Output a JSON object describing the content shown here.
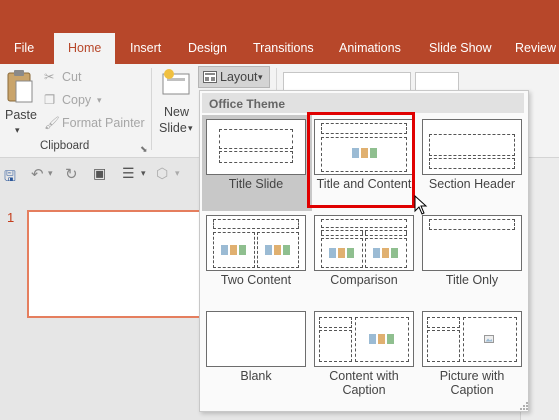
{
  "tabs": [
    "File",
    "Home",
    "Insert",
    "Design",
    "Transitions",
    "Animations",
    "Slide Show",
    "Review"
  ],
  "active_tab": "Home",
  "clipboard": {
    "paste": "Paste",
    "cut": "Cut",
    "copy": "Copy",
    "format_painter": "Format Painter",
    "group_label": "Clipboard"
  },
  "slides_group": {
    "new_slide_line1": "New",
    "new_slide_line2": "Slide",
    "layout_button": "Layout"
  },
  "slide_pane": {
    "slide_number": "1"
  },
  "layout_gallery": {
    "header": "Office Theme",
    "items": [
      {
        "label": "Title Slide"
      },
      {
        "label": "Title and Content"
      },
      {
        "label": "Section Header"
      },
      {
        "label": "Two Content"
      },
      {
        "label": "Comparison"
      },
      {
        "label": "Title Only"
      },
      {
        "label": "Blank"
      },
      {
        "label": "Content with Caption"
      },
      {
        "label": "Picture with Caption"
      }
    ],
    "selected": "Title Slide",
    "hovered": "Title and Content"
  },
  "colors": {
    "accent": "#b7472a",
    "highlight": "#e00000"
  }
}
